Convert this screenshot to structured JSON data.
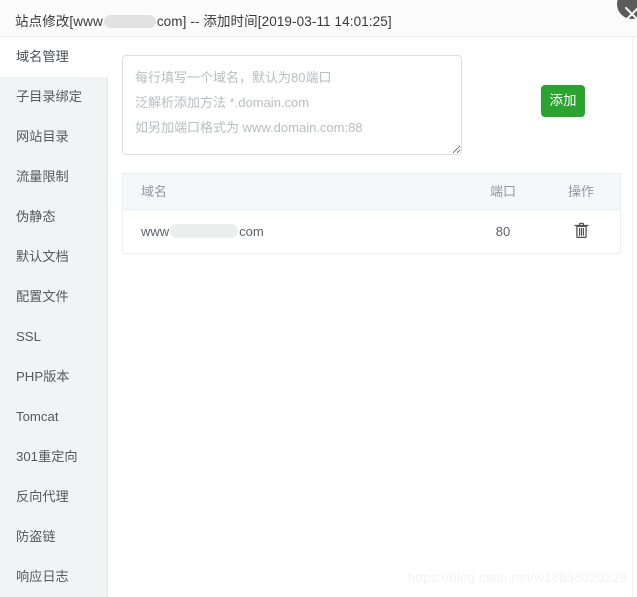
{
  "window": {
    "title_prefix": "站点修改[www",
    "title_suffix": "com] -- 添加时间[2019-03-11 14:01:25]",
    "close_icon": "close-icon"
  },
  "sidebar": {
    "items": [
      {
        "label": "域名管理",
        "active": true
      },
      {
        "label": "子目录绑定",
        "active": false
      },
      {
        "label": "网站目录",
        "active": false
      },
      {
        "label": "流量限制",
        "active": false
      },
      {
        "label": "伪静态",
        "active": false
      },
      {
        "label": "默认文档",
        "active": false
      },
      {
        "label": "配置文件",
        "active": false
      },
      {
        "label": "SSL",
        "active": false
      },
      {
        "label": "PHP版本",
        "active": false
      },
      {
        "label": "Tomcat",
        "active": false
      },
      {
        "label": "301重定向",
        "active": false
      },
      {
        "label": "反向代理",
        "active": false
      },
      {
        "label": "防盗链",
        "active": false
      },
      {
        "label": "响应日志",
        "active": false
      }
    ]
  },
  "main": {
    "domain_input": {
      "value": "",
      "placeholder": "每行填写一个域名，默认为80端口\n泛解析添加方法 *.domain.com\n如另加端口格式为 www.domain.com:88"
    },
    "add_button_label": "添加",
    "add_button_color": "#2aa331",
    "table": {
      "headers": {
        "domain": "域名",
        "port": "端口",
        "operation": "操作"
      },
      "rows": [
        {
          "domain_prefix": "www",
          "domain_suffix": "com",
          "port": "80",
          "delete_icon": "trash-icon"
        }
      ]
    }
  },
  "watermark": {
    "text": "https://blog.csdn.net/w18838020329"
  }
}
